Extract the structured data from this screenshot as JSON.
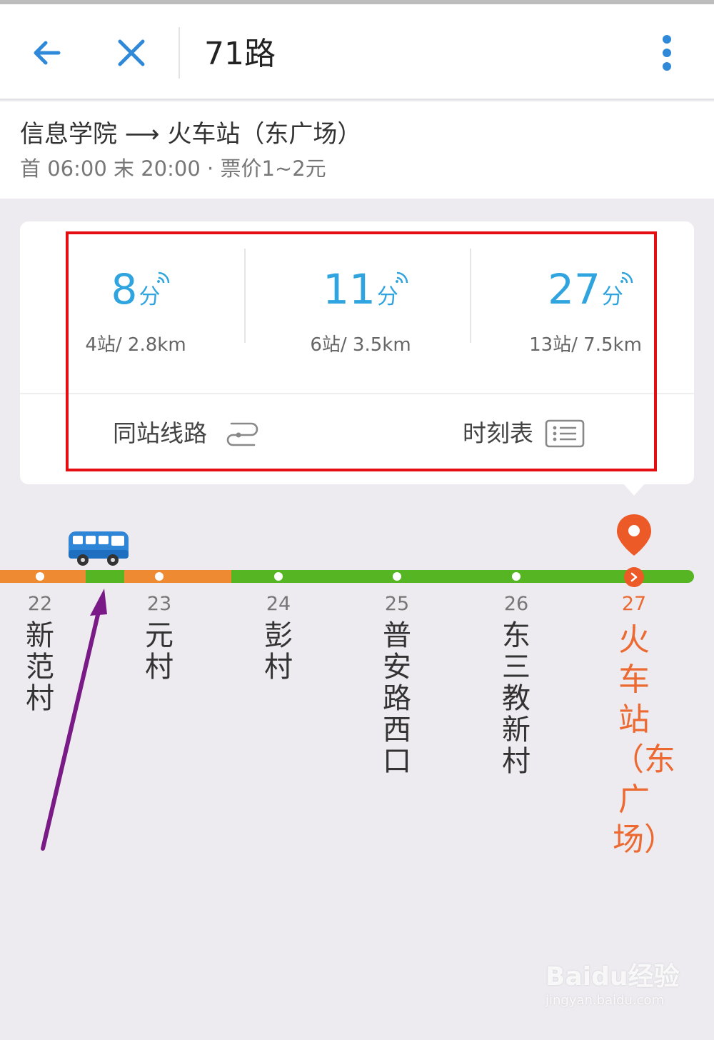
{
  "header": {
    "title": "71路",
    "back_icon": "back-arrow-icon",
    "close_icon": "close-icon",
    "more_icon": "more-vertical-icon"
  },
  "info": {
    "route": "信息学院 ⟶ 火车站（东广场）",
    "schedule": "首 06:00 末 20:00 · 票价1~2元"
  },
  "arrivals": [
    {
      "minutes": "8",
      "unit": "分",
      "detail": "4站/ 2.8km"
    },
    {
      "minutes": "11",
      "unit": "分",
      "detail": "6站/ 3.5km"
    },
    {
      "minutes": "27",
      "unit": "分",
      "detail": "13站/ 7.5km"
    }
  ],
  "links": {
    "same_station": "同站线路",
    "timetable": "时刻表"
  },
  "stops": [
    {
      "num": "22",
      "name": "新范村"
    },
    {
      "num": "23",
      "name": "元村"
    },
    {
      "num": "24",
      "name": "彭村"
    },
    {
      "num": "25",
      "name": "普安路西口"
    },
    {
      "num": "26",
      "name": "东三教新村"
    },
    {
      "num": "27",
      "name": "火车站（东广场）"
    }
  ],
  "colors": {
    "accent": "#2fa4de",
    "destination": "#ec6a31",
    "track_green": "#55b523",
    "track_orange": "#ee8a31",
    "highlight": "#e40d12",
    "annotation": "#7a1a86"
  },
  "watermark": {
    "main": "Baidu经验",
    "sub": "jingyan.baidu.com"
  }
}
